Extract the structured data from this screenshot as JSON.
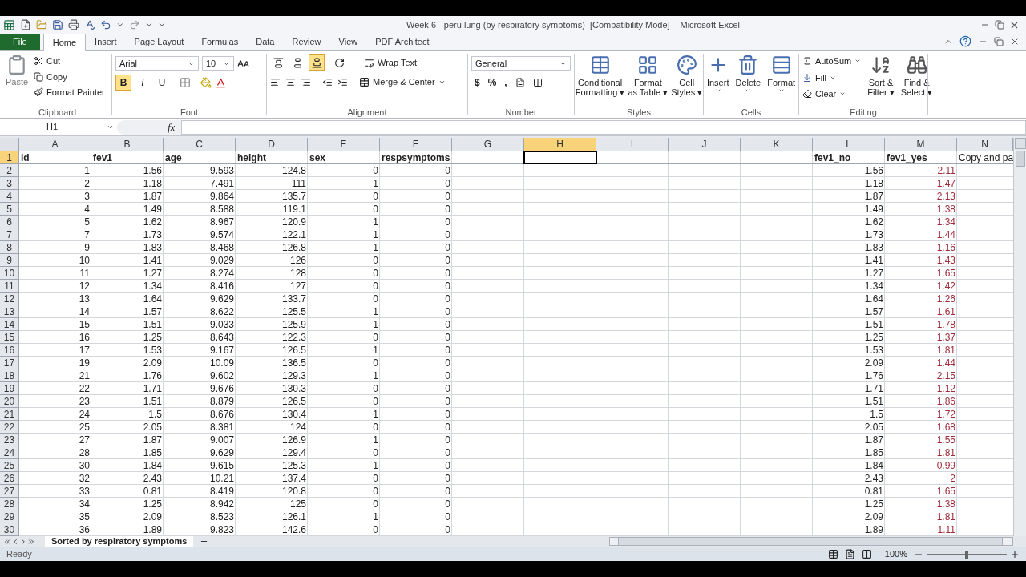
{
  "window": {
    "title": "Week 6 - peru lung (by respiratory symptoms)  [Compatibility Mode]  - Microsoft Excel"
  },
  "tabs": [
    {
      "label": "File",
      "kind": "file",
      "selected": false
    },
    {
      "label": "Home",
      "kind": "tab",
      "selected": true
    },
    {
      "label": "Insert",
      "kind": "tab",
      "selected": false
    },
    {
      "label": "Page Layout",
      "kind": "tab",
      "selected": false
    },
    {
      "label": "Formulas",
      "kind": "tab",
      "selected": false
    },
    {
      "label": "Data",
      "kind": "tab",
      "selected": false
    },
    {
      "label": "Review",
      "kind": "tab",
      "selected": false
    },
    {
      "label": "View",
      "kind": "tab",
      "selected": false
    },
    {
      "label": "PDF Architect",
      "kind": "tab",
      "selected": false
    }
  ],
  "ribbon": {
    "clipboard": {
      "title": "Clipboard",
      "paste": "Paste",
      "cut": "Cut",
      "copy": "Copy",
      "format_painter": "Format Painter"
    },
    "font": {
      "title": "Font",
      "font_name": "Arial",
      "font_size": "10",
      "style_buttons": [
        {
          "label": "B",
          "kind": "bold",
          "pressed": true
        },
        {
          "label": "I",
          "kind": "italic",
          "pressed": false
        },
        {
          "label": "U",
          "kind": "underline",
          "pressed": false
        }
      ]
    },
    "alignment": {
      "title": "Alignment",
      "wrap_text": "Wrap Text",
      "merge_center": "Merge & Center",
      "vertical_buttons": [
        {
          "kind": "top",
          "pressed": false
        },
        {
          "kind": "middle",
          "pressed": false
        },
        {
          "kind": "bottom",
          "pressed": true
        }
      ]
    },
    "number": {
      "title": "Number",
      "format": "General",
      "symbols": [
        "$",
        "%",
        ","
      ]
    },
    "styles": {
      "title": "Styles",
      "buttons": [
        {
          "lines": [
            "Conditional",
            "Formatting ▾"
          ],
          "kind": "conditional"
        },
        {
          "lines": [
            "Format",
            "as Table ▾"
          ],
          "kind": "table"
        },
        {
          "lines": [
            "Cell",
            "Styles ▾"
          ],
          "kind": "cellstyle"
        }
      ]
    },
    "cells": {
      "title": "Cells",
      "buttons": [
        {
          "label": "Insert",
          "kind": "insert"
        },
        {
          "label": "Delete",
          "kind": "delete"
        },
        {
          "label": "Format",
          "kind": "format"
        }
      ]
    },
    "editing": {
      "title": "Editing",
      "autosum": "AutoSum",
      "fill": "Fill",
      "clear": "Clear",
      "sort_filter": [
        "Sort &",
        "Filter ▾"
      ],
      "find_select": [
        "Find &",
        "Select ▾"
      ]
    }
  },
  "formula_bar": {
    "name_box": "H1",
    "function_label": "fx"
  },
  "columns": [
    {
      "letter": "A",
      "selected": false
    },
    {
      "letter": "B",
      "selected": false
    },
    {
      "letter": "C",
      "selected": false
    },
    {
      "letter": "D",
      "selected": false
    },
    {
      "letter": "E",
      "selected": false
    },
    {
      "letter": "F",
      "selected": false
    },
    {
      "letter": "G",
      "selected": false
    },
    {
      "letter": "H",
      "selected": true
    },
    {
      "letter": "I",
      "selected": false
    },
    {
      "letter": "J",
      "selected": false
    },
    {
      "letter": "K",
      "selected": false
    },
    {
      "letter": "L",
      "selected": false
    },
    {
      "letter": "M",
      "selected": false,
      "color": "#a02a3a"
    },
    {
      "letter": "N",
      "selected": false
    }
  ],
  "rows": [
    {
      "number": "1",
      "selected": true,
      "header": true,
      "cells": {
        "A": "id",
        "B": "fev1",
        "C": "age",
        "D": "height",
        "E": "sex",
        "F": "respsymptoms",
        "L": "fev1_no",
        "M": "fev1_yes"
      },
      "plain_cells": {
        "N": "Copy and pa"
      }
    },
    {
      "number": "2",
      "selected": false,
      "cells": {
        "A": "1",
        "B": "1.56",
        "C": "9.593",
        "D": "124.8",
        "E": "0",
        "F": "0",
        "L": "1.56",
        "M": "2.11"
      }
    },
    {
      "number": "3",
      "selected": false,
      "cells": {
        "A": "2",
        "B": "1.18",
        "C": "7.491",
        "D": "111",
        "E": "1",
        "F": "0",
        "L": "1.18",
        "M": "1.47"
      }
    },
    {
      "number": "4",
      "selected": false,
      "cells": {
        "A": "3",
        "B": "1.87",
        "C": "9.864",
        "D": "135.7",
        "E": "0",
        "F": "0",
        "L": "1.87",
        "M": "2.13"
      }
    },
    {
      "number": "5",
      "selected": false,
      "cells": {
        "A": "4",
        "B": "1.49",
        "C": "8.588",
        "D": "119.1",
        "E": "0",
        "F": "0",
        "L": "1.49",
        "M": "1.38"
      }
    },
    {
      "number": "6",
      "selected": false,
      "cells": {
        "A": "5",
        "B": "1.62",
        "C": "8.967",
        "D": "120.9",
        "E": "1",
        "F": "0",
        "L": "1.62",
        "M": "1.34"
      }
    },
    {
      "number": "7",
      "selected": false,
      "cells": {
        "A": "7",
        "B": "1.73",
        "C": "9.574",
        "D": "122.1",
        "E": "1",
        "F": "0",
        "L": "1.73",
        "M": "1.44"
      }
    },
    {
      "number": "8",
      "selected": false,
      "cells": {
        "A": "9",
        "B": "1.83",
        "C": "8.468",
        "D": "126.8",
        "E": "1",
        "F": "0",
        "L": "1.83",
        "M": "1.16"
      }
    },
    {
      "number": "9",
      "selected": false,
      "cells": {
        "A": "10",
        "B": "1.41",
        "C": "9.029",
        "D": "126",
        "E": "0",
        "F": "0",
        "L": "1.41",
        "M": "1.43"
      }
    },
    {
      "number": "10",
      "selected": false,
      "cells": {
        "A": "11",
        "B": "1.27",
        "C": "8.274",
        "D": "128",
        "E": "0",
        "F": "0",
        "L": "1.27",
        "M": "1.65"
      }
    },
    {
      "number": "11",
      "selected": false,
      "cells": {
        "A": "12",
        "B": "1.34",
        "C": "8.416",
        "D": "127",
        "E": "0",
        "F": "0",
        "L": "1.34",
        "M": "1.42"
      }
    },
    {
      "number": "12",
      "selected": false,
      "cells": {
        "A": "13",
        "B": "1.64",
        "C": "9.629",
        "D": "133.7",
        "E": "0",
        "F": "0",
        "L": "1.64",
        "M": "1.26"
      }
    },
    {
      "number": "13",
      "selected": false,
      "cells": {
        "A": "14",
        "B": "1.57",
        "C": "8.622",
        "D": "125.5",
        "E": "1",
        "F": "0",
        "L": "1.57",
        "M": "1.61"
      }
    },
    {
      "number": "14",
      "selected": false,
      "cells": {
        "A": "15",
        "B": "1.51",
        "C": "9.033",
        "D": "125.9",
        "E": "1",
        "F": "0",
        "L": "1.51",
        "M": "1.78"
      }
    },
    {
      "number": "15",
      "selected": false,
      "cells": {
        "A": "16",
        "B": "1.25",
        "C": "8.643",
        "D": "122.3",
        "E": "0",
        "F": "0",
        "L": "1.25",
        "M": "1.37"
      }
    },
    {
      "number": "16",
      "selected": false,
      "cells": {
        "A": "17",
        "B": "1.53",
        "C": "9.167",
        "D": "126.5",
        "E": "1",
        "F": "0",
        "L": "1.53",
        "M": "1.81"
      }
    },
    {
      "number": "17",
      "selected": false,
      "cells": {
        "A": "19",
        "B": "2.09",
        "C": "10.09",
        "D": "136.5",
        "E": "0",
        "F": "0",
        "L": "2.09",
        "M": "1.44"
      }
    },
    {
      "number": "18",
      "selected": false,
      "cells": {
        "A": "21",
        "B": "1.76",
        "C": "9.602",
        "D": "129.3",
        "E": "1",
        "F": "0",
        "L": "1.76",
        "M": "2.15"
      }
    },
    {
      "number": "19",
      "selected": false,
      "cells": {
        "A": "22",
        "B": "1.71",
        "C": "9.676",
        "D": "130.3",
        "E": "0",
        "F": "0",
        "L": "1.71",
        "M": "1.12"
      }
    },
    {
      "number": "20",
      "selected": false,
      "cells": {
        "A": "23",
        "B": "1.51",
        "C": "8.879",
        "D": "126.5",
        "E": "0",
        "F": "0",
        "L": "1.51",
        "M": "1.86"
      }
    },
    {
      "number": "21",
      "selected": false,
      "cells": {
        "A": "24",
        "B": "1.5",
        "C": "8.676",
        "D": "130.4",
        "E": "1",
        "F": "0",
        "L": "1.5",
        "M": "1.72"
      }
    },
    {
      "number": "22",
      "selected": false,
      "cells": {
        "A": "25",
        "B": "2.05",
        "C": "8.381",
        "D": "124",
        "E": "0",
        "F": "0",
        "L": "2.05",
        "M": "1.68"
      }
    },
    {
      "number": "23",
      "selected": false,
      "cells": {
        "A": "27",
        "B": "1.87",
        "C": "9.007",
        "D": "126.9",
        "E": "1",
        "F": "0",
        "L": "1.87",
        "M": "1.55"
      }
    },
    {
      "number": "24",
      "selected": false,
      "cells": {
        "A": "28",
        "B": "1.85",
        "C": "9.629",
        "D": "129.4",
        "E": "0",
        "F": "0",
        "L": "1.85",
        "M": "1.81"
      }
    },
    {
      "number": "25",
      "selected": false,
      "cells": {
        "A": "30",
        "B": "1.84",
        "C": "9.615",
        "D": "125.3",
        "E": "1",
        "F": "0",
        "L": "1.84",
        "M": "0.99"
      }
    },
    {
      "number": "26",
      "selected": false,
      "cells": {
        "A": "32",
        "B": "2.43",
        "C": "10.21",
        "D": "137.4",
        "E": "0",
        "F": "0",
        "L": "2.43",
        "M": "2"
      }
    },
    {
      "number": "27",
      "selected": false,
      "cells": {
        "A": "33",
        "B": "0.81",
        "C": "8.419",
        "D": "120.8",
        "E": "0",
        "F": "0",
        "L": "0.81",
        "M": "1.65"
      }
    },
    {
      "number": "28",
      "selected": false,
      "cells": {
        "A": "34",
        "B": "1.25",
        "C": "8.942",
        "D": "125",
        "E": "0",
        "F": "0",
        "L": "1.25",
        "M": "1.38"
      }
    },
    {
      "number": "29",
      "selected": false,
      "cells": {
        "A": "35",
        "B": "2.09",
        "C": "8.523",
        "D": "126.1",
        "E": "1",
        "F": "0",
        "L": "2.09",
        "M": "1.81"
      }
    },
    {
      "number": "30",
      "selected": false,
      "cells": {
        "A": "36",
        "B": "1.89",
        "C": "9.823",
        "D": "142.6",
        "E": "0",
        "F": "0",
        "L": "1.89",
        "M": "1.11"
      }
    }
  ],
  "sheet_tabs": [
    {
      "label": "Sorted by respiratory symptoms",
      "selected": true
    }
  ],
  "status_bar": {
    "status": "Ready",
    "zoom": "100%",
    "level": 0.5
  }
}
